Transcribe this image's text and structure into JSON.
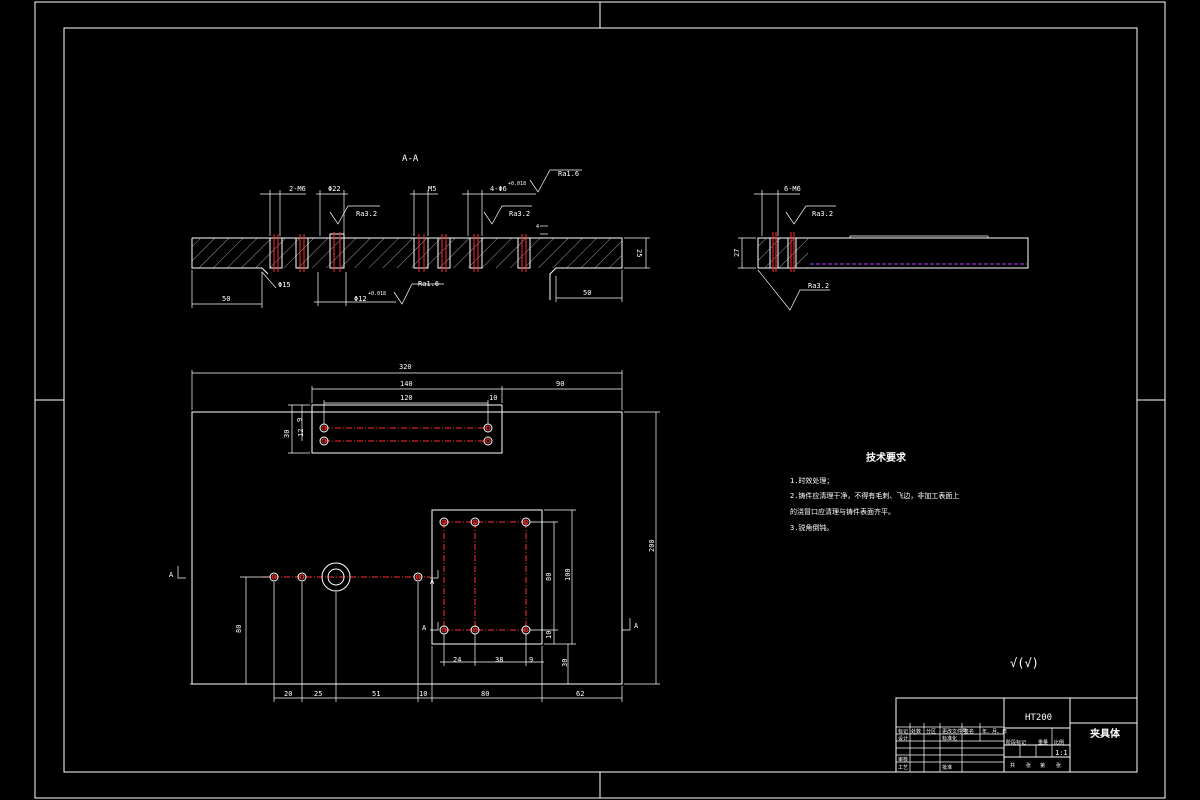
{
  "section": {
    "title": "A-A",
    "callouts": {
      "tapped_2": "2-M6",
      "bore_top": "Φ22",
      "tapped_m5": "M5",
      "holes_4": "4-Φ6",
      "holes_4_tol": "+0.018",
      "counterbore": "Φ15",
      "bore_bottom": "Φ12",
      "bore_bottom_tol": "+0.018",
      "left_len": "50",
      "right_len": "50",
      "height": "25",
      "step_depth": "4"
    },
    "roughness": {
      "ra16_top": "Ra1.6",
      "ra32_a": "Ra3.2",
      "ra32_b": "Ra3.2",
      "ra16_bottom": "Ra1.6"
    }
  },
  "side": {
    "callout": "6-M6",
    "height": "27",
    "ra32_top": "Ra3.2",
    "ra32_bottom": "Ra3.2"
  },
  "plan": {
    "overall_width": "320",
    "dim_140": "140",
    "dim_90": "90",
    "dim_120": "120",
    "dim_10a": "10",
    "dim_9": "9",
    "dim_12": "12",
    "dim_30": "30",
    "height": "200",
    "dim_100": "100",
    "dim_80": "80",
    "dim_10b": "10",
    "dim_30b": "30",
    "dim_80v": "80",
    "dim_24": "24",
    "dim_38": "38",
    "dim_9b": "9",
    "bottom_dims": [
      "20",
      "25",
      "51",
      "10",
      "80",
      "62"
    ],
    "section_mark": "A"
  },
  "notes": {
    "title": "技术要求",
    "lines": [
      "1.时效处理；",
      "2.铸件应清理干净，不得有毛刺、飞边，非加工表面上",
      "的浇冒口应清理与铸件表面齐平。",
      "3.锐角倒钝。"
    ]
  },
  "roughness_general": "√(√)",
  "title_block": {
    "material": "HT200",
    "part_name": "夹具体",
    "scale": "1:1",
    "labels": [
      "标记",
      "处数",
      "分区",
      "更改文件号",
      "签名",
      "年、月、日",
      "设计",
      "标准化",
      "阶段标记",
      "重量",
      "比例",
      "审核",
      "工艺",
      "批准",
      "共",
      "张",
      "第",
      "张"
    ]
  },
  "colors": {
    "background": "#000000",
    "line": "#ffffff",
    "centerline": "#ff2b2b",
    "phantom": "#c040ff"
  }
}
